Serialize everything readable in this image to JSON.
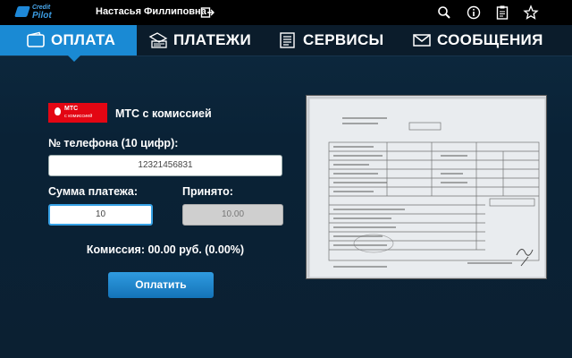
{
  "topbar": {
    "logo_line1": "Credit",
    "logo_line2": "Pilot",
    "username": "Настасья Филлиповна",
    "icons": [
      "search-icon",
      "info-icon",
      "clipboard-icon",
      "star-icon"
    ]
  },
  "nav": {
    "tabs": [
      {
        "label": "ОПЛАТА",
        "icon": "wallet-icon",
        "active": true
      },
      {
        "label": "ПЛАТЕЖИ",
        "icon": "payments-icon",
        "active": false
      },
      {
        "label": "СЕРВИСЫ",
        "icon": "list-icon",
        "active": false
      },
      {
        "label": "СООБЩЕНИЯ",
        "icon": "envelope-icon",
        "active": false
      }
    ]
  },
  "form": {
    "provider_logo_line1": "МТС",
    "provider_logo_line2": "с комиссией",
    "provider_name": "МТС с комиссией",
    "phone_label": "№ телефона (10 цифр):",
    "phone_value": "12321456831",
    "amount_label": "Сумма платежа:",
    "amount_value": "10",
    "accepted_label": "Принято:",
    "accepted_value": "10.00",
    "commission_text": "Комиссия: 00.00 руб. (0.00%)",
    "pay_button": "Оплатить"
  },
  "colors": {
    "accent": "#1a8ad4",
    "topbar": "#000000",
    "background": "#0b2032",
    "mts_red": "#e30613"
  },
  "receipt_photo": {
    "icon": "receipt-photo"
  }
}
